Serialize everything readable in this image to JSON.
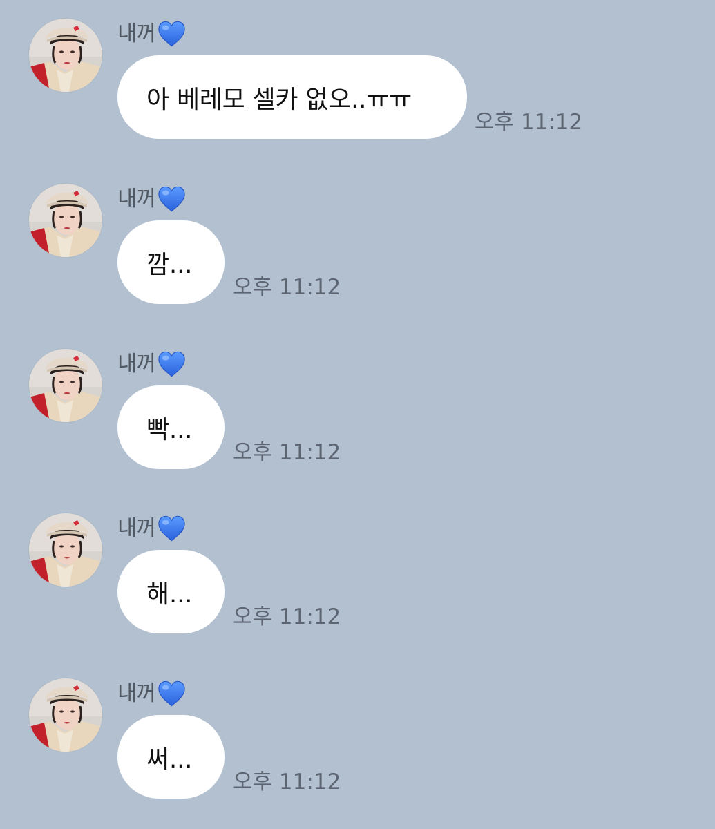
{
  "chat": {
    "messages": [
      {
        "sender": "내꺼",
        "sender_icon": "blue-heart-icon",
        "text": "아 베레모 셀카 없오..ㅠㅠ",
        "time": "오후 11:12"
      },
      {
        "sender": "내꺼",
        "sender_icon": "blue-heart-icon",
        "text": "깜...",
        "time": "오후 11:12"
      },
      {
        "sender": "내꺼",
        "sender_icon": "blue-heart-icon",
        "text": "빡...",
        "time": "오후 11:12"
      },
      {
        "sender": "내꺼",
        "sender_icon": "blue-heart-icon",
        "text": "해...",
        "time": "오후 11:12"
      },
      {
        "sender": "내꺼",
        "sender_icon": "blue-heart-icon",
        "text": "써...",
        "time": "오후 11:12"
      }
    ]
  },
  "colors": {
    "background": "#b2c0d0",
    "bubble": "#ffffff",
    "heart": "#3a7bf0"
  }
}
